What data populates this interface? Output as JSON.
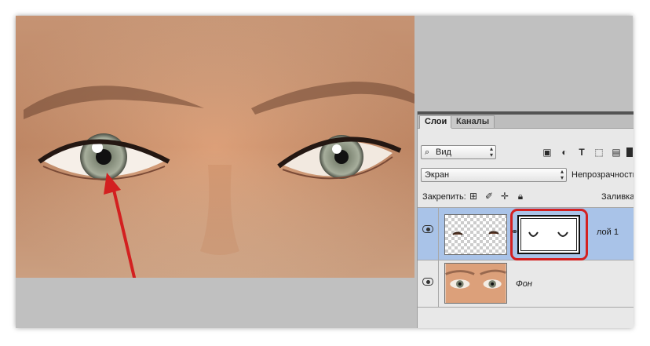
{
  "layers_panel": {
    "tabs": [
      {
        "label": "Слои",
        "active": true
      },
      {
        "label": "Каналы",
        "active": false
      }
    ],
    "filter": {
      "value": "Вид",
      "icon": "search-icon"
    },
    "filter_icons": [
      "image-filter-icon",
      "adjustment-filter-icon",
      "type-filter-icon",
      "shape-filter-icon",
      "smart-object-filter-icon"
    ],
    "blend_mode": "Экран",
    "opacity_label": "Непрозрачность",
    "lock_label": "Закрепить:",
    "lock_icons": [
      "lock-transparent-icon",
      "lock-paint-icon",
      "lock-move-icon",
      "lock-all-icon"
    ],
    "fill_label": "Заливка",
    "layers": [
      {
        "name": "лой 1",
        "selected": true,
        "visible": true,
        "has_mask": true
      },
      {
        "name": "Фон",
        "selected": false,
        "visible": true,
        "has_mask": false
      }
    ]
  },
  "annotation": {
    "color": "#d32020"
  }
}
